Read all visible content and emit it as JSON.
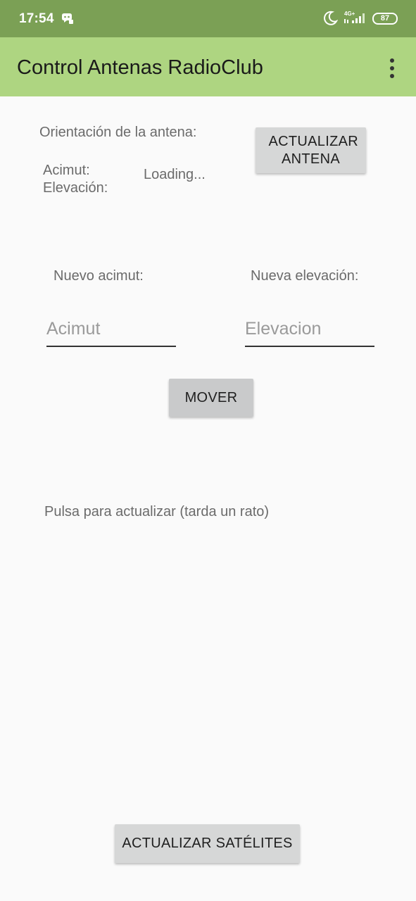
{
  "status_bar": {
    "time": "17:54",
    "network_type": "4G+",
    "battery_level": "87",
    "colors": {
      "background": "#7ba055",
      "foreground": "#ffffff"
    },
    "icons": [
      "notification-icon",
      "moon-icon",
      "signal-icon",
      "battery-icon"
    ]
  },
  "app_bar": {
    "title": "Control Antenas RadioClub",
    "background": "#aed581",
    "menu_icon": "more-vert-icon"
  },
  "antenna": {
    "orientation_label": "Orientación de la antena:",
    "azimuth_label": "Acimut:",
    "elevation_label": "Elevación:",
    "status_value": "Loading...",
    "update_button": "ACTUALIZAR ANTENA"
  },
  "move": {
    "new_azimuth_label": "Nuevo acimut:",
    "new_elevation_label": "Nueva elevación:",
    "azimuth_input": {
      "value": "",
      "placeholder": "Acimut"
    },
    "elevation_input": {
      "value": "",
      "placeholder": "Elevacion"
    },
    "move_button": "MOVER"
  },
  "satellites": {
    "hint": "Pulsa para actualizar (tarda un rato)",
    "update_button": "ACTUALIZAR SATÉLITES"
  }
}
